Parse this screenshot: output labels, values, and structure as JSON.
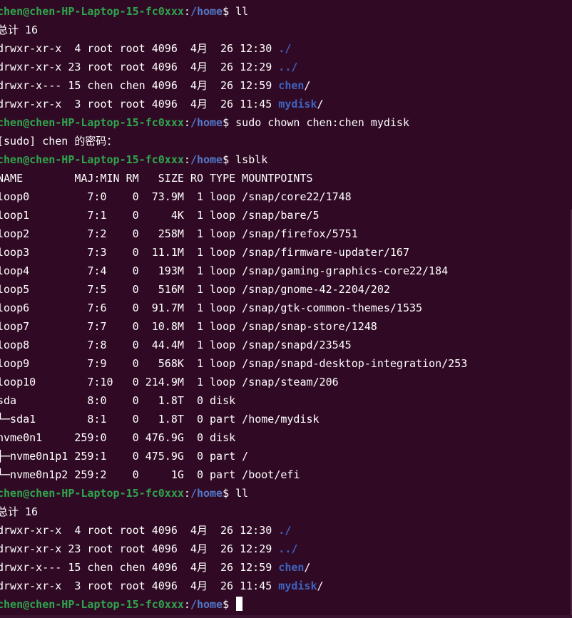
{
  "terminal": {
    "background": "#300a24",
    "colors": {
      "user_host": "#2fa54d",
      "path": "#5478c8",
      "directory": "#3e63c0",
      "text": "#ffffff"
    },
    "lines": [
      [
        {
          "t": "chen@chen-HP-Laptop-15-fc0xxx",
          "c": "user"
        },
        {
          "t": ":",
          "c": "text"
        },
        {
          "t": "/home",
          "c": "path"
        },
        {
          "t": "$ ll",
          "c": "text"
        }
      ],
      [
        {
          "t": "总计 16",
          "c": "text"
        }
      ],
      [
        {
          "t": "drwxr-xr-x  4 root root 4096  4月  26 12:30 ",
          "c": "text"
        },
        {
          "t": "./",
          "c": "dir"
        }
      ],
      [
        {
          "t": "drwxr-xr-x 23 root root 4096  4月  26 12:29 ",
          "c": "text"
        },
        {
          "t": "../",
          "c": "dir"
        }
      ],
      [
        {
          "t": "drwxr-x--- 15 chen chen 4096  4月  26 12:59 ",
          "c": "text"
        },
        {
          "t": "chen",
          "c": "dir"
        },
        {
          "t": "/",
          "c": "text"
        }
      ],
      [
        {
          "t": "drwxr-xr-x  3 root root 4096  4月  26 11:45 ",
          "c": "text"
        },
        {
          "t": "mydisk",
          "c": "dir"
        },
        {
          "t": "/",
          "c": "text"
        }
      ],
      [
        {
          "t": "chen@chen-HP-Laptop-15-fc0xxx",
          "c": "user"
        },
        {
          "t": ":",
          "c": "text"
        },
        {
          "t": "/home",
          "c": "path"
        },
        {
          "t": "$ sudo chown chen:chen mydisk",
          "c": "text"
        }
      ],
      [
        {
          "t": "[sudo] chen 的密码：",
          "c": "text"
        }
      ],
      [
        {
          "t": "chen@chen-HP-Laptop-15-fc0xxx",
          "c": "user"
        },
        {
          "t": ":",
          "c": "text"
        },
        {
          "t": "/home",
          "c": "path"
        },
        {
          "t": "$ lsblk",
          "c": "text"
        }
      ],
      [
        {
          "t": "NAME        MAJ:MIN RM   SIZE RO TYPE MOUNTPOINTS",
          "c": "text"
        }
      ],
      [
        {
          "t": "loop0         7:0    0  73.9M  1 loop /snap/core22/1748",
          "c": "text"
        }
      ],
      [
        {
          "t": "loop1         7:1    0     4K  1 loop /snap/bare/5",
          "c": "text"
        }
      ],
      [
        {
          "t": "loop2         7:2    0   258M  1 loop /snap/firefox/5751",
          "c": "text"
        }
      ],
      [
        {
          "t": "loop3         7:3    0  11.1M  1 loop /snap/firmware-updater/167",
          "c": "text"
        }
      ],
      [
        {
          "t": "loop4         7:4    0   193M  1 loop /snap/gaming-graphics-core22/184",
          "c": "text"
        }
      ],
      [
        {
          "t": "loop5         7:5    0   516M  1 loop /snap/gnome-42-2204/202",
          "c": "text"
        }
      ],
      [
        {
          "t": "loop6         7:6    0  91.7M  1 loop /snap/gtk-common-themes/1535",
          "c": "text"
        }
      ],
      [
        {
          "t": "loop7         7:7    0  10.8M  1 loop /snap/snap-store/1248",
          "c": "text"
        }
      ],
      [
        {
          "t": "loop8         7:8    0  44.4M  1 loop /snap/snapd/23545",
          "c": "text"
        }
      ],
      [
        {
          "t": "loop9         7:9    0   568K  1 loop /snap/snapd-desktop-integration/253",
          "c": "text"
        }
      ],
      [
        {
          "t": "loop10        7:10   0 214.9M  1 loop /snap/steam/206",
          "c": "text"
        }
      ],
      [
        {
          "t": "sda           8:0    0   1.8T  0 disk",
          "c": "text"
        }
      ],
      [
        {
          "t": "└─sda1        8:1    0   1.8T  0 part /home/mydisk",
          "c": "text"
        }
      ],
      [
        {
          "t": "nvme0n1     259:0    0 476.9G  0 disk",
          "c": "text"
        }
      ],
      [
        {
          "t": "├─nvme0n1p1 259:1    0 475.9G  0 part /",
          "c": "text"
        }
      ],
      [
        {
          "t": "└─nvme0n1p2 259:2    0     1G  0 part /boot/efi",
          "c": "text"
        }
      ],
      [
        {
          "t": "chen@chen-HP-Laptop-15-fc0xxx",
          "c": "user"
        },
        {
          "t": ":",
          "c": "text"
        },
        {
          "t": "/home",
          "c": "path"
        },
        {
          "t": "$ ll",
          "c": "text"
        }
      ],
      [
        {
          "t": "总计 16",
          "c": "text"
        }
      ],
      [
        {
          "t": "drwxr-xr-x  4 root root 4096  4月  26 12:30 ",
          "c": "text"
        },
        {
          "t": "./",
          "c": "dir"
        }
      ],
      [
        {
          "t": "drwxr-xr-x 23 root root 4096  4月  26 12:29 ",
          "c": "text"
        },
        {
          "t": "../",
          "c": "dir"
        }
      ],
      [
        {
          "t": "drwxr-x--- 15 chen chen 4096  4月  26 12:59 ",
          "c": "text"
        },
        {
          "t": "chen",
          "c": "dir"
        },
        {
          "t": "/",
          "c": "text"
        }
      ],
      [
        {
          "t": "drwxr-xr-x  3 root root 4096  4月  26 11:45 ",
          "c": "text"
        },
        {
          "t": "mydisk",
          "c": "dir"
        },
        {
          "t": "/",
          "c": "text"
        }
      ],
      [
        {
          "t": "chen@chen-HP-Laptop-15-fc0xxx",
          "c": "user"
        },
        {
          "t": ":",
          "c": "text"
        },
        {
          "t": "/home",
          "c": "path"
        },
        {
          "t": "$ ",
          "c": "text"
        },
        {
          "cursor": true
        }
      ]
    ]
  }
}
